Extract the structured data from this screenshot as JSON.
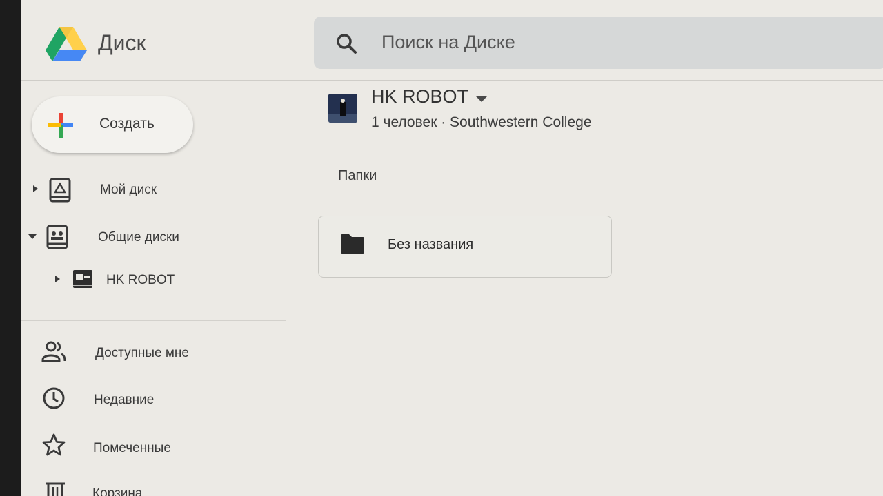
{
  "header": {
    "app_name": "Диск",
    "search_placeholder": "Поиск на Диске"
  },
  "sidebar": {
    "create_label": "Создать",
    "items": [
      {
        "label": "Мой диск",
        "icon": "my-drive-icon"
      },
      {
        "label": "Общие диски",
        "icon": "shared-drives-icon"
      },
      {
        "label": "HK ROBOT",
        "icon": "shared-drive-icon"
      },
      {
        "label": "Доступные мне",
        "icon": "shared-with-me-icon"
      },
      {
        "label": "Недавние",
        "icon": "clock-icon"
      },
      {
        "label": "Помеченные",
        "icon": "star-icon"
      },
      {
        "label": "Корзина",
        "icon": "trash-icon"
      }
    ]
  },
  "main": {
    "drive_name": "HK ROBOT",
    "drive_meta": "1 человек · Southwestern College",
    "folders_section": "Папки",
    "folders": [
      {
        "name": "Без названия"
      }
    ]
  },
  "colors": {
    "drive_green": "#1fa463",
    "drive_yellow": "#ffd04b",
    "drive_blue": "#4688f4",
    "plus_red": "#ea4335",
    "plus_blue": "#4285f4",
    "plus_green": "#34a853",
    "plus_yellow": "#fbbc05"
  }
}
